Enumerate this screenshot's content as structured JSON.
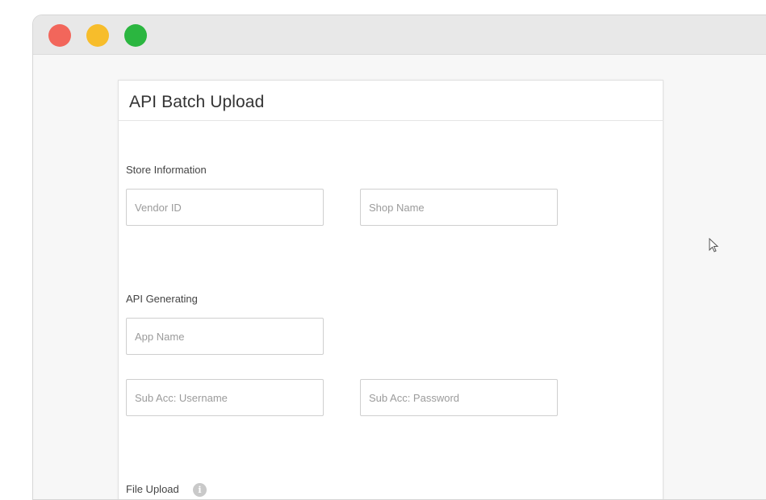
{
  "window": {
    "controls": [
      "close",
      "minimize",
      "maximize"
    ]
  },
  "panel": {
    "title": "API Batch Upload"
  },
  "store_information": {
    "label": "Store Information",
    "vendor_id_placeholder": "Vendor ID",
    "shop_name_placeholder": "Shop Name"
  },
  "api_generating": {
    "label": "API Generating",
    "app_name_placeholder": "App Name",
    "sub_acc_username_placeholder": "Sub Acc: Username",
    "sub_acc_password_placeholder": "Sub Acc: Password"
  },
  "file_upload": {
    "label": "File Upload",
    "info_icon": "info-icon"
  },
  "colors": {
    "close": "#f2665b",
    "minimize": "#f7bd2b",
    "maximize": "#2bb640"
  }
}
